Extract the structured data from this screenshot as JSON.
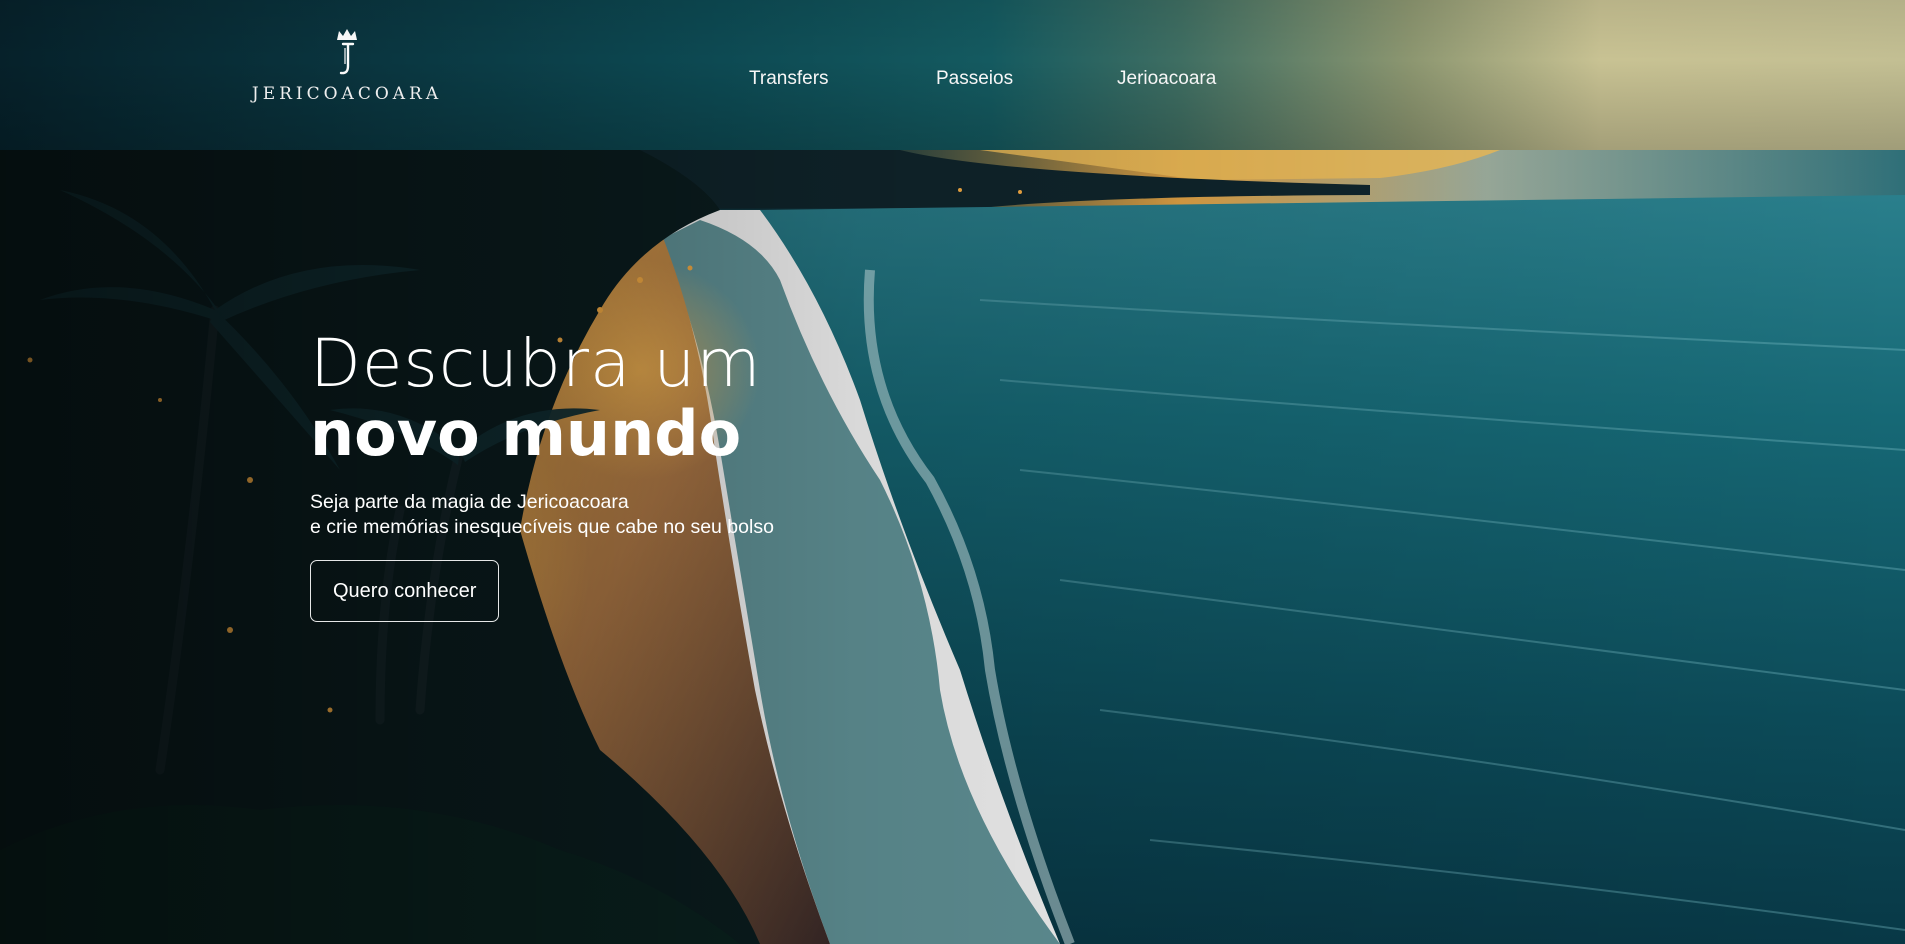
{
  "header": {
    "logo_text": "JERICOACOARA",
    "nav": [
      {
        "label": "Transfers"
      },
      {
        "label": "Passeios"
      },
      {
        "label": "Jerioacoara"
      }
    ]
  },
  "hero": {
    "title_light": "Descubra um",
    "title_bold": "novo mundo",
    "subtitle_line1": "Seja parte da magia de Jericoacoara",
    "subtitle_line2": "e crie memórias inesquecíveis que cabe no seu bolso",
    "cta_label": "Quero conhecer"
  },
  "colors": {
    "header_dark": "#06212a",
    "header_light": "#c3bf93",
    "ocean": "#0b4f5c",
    "sand_glow": "#e3a24a",
    "text": "#ffffff"
  },
  "icons": {
    "logo_mark": "crowned-j-icon"
  }
}
